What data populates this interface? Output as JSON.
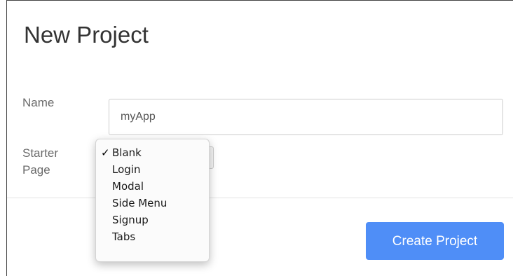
{
  "dialog": {
    "title": "New Project",
    "name_label": "Name",
    "name_value": "myApp",
    "starter_label": "Starter Page",
    "create_button_label": "Create Project"
  },
  "starter_dropdown": {
    "selected": "Blank",
    "check_glyph": "✓",
    "options": [
      "Blank",
      "Login",
      "Modal",
      "Side Menu",
      "Signup",
      "Tabs"
    ]
  },
  "colors": {
    "accent": "#4f8ef7",
    "title_text": "#333333",
    "label_text": "#6b6b6b"
  },
  "icons": {
    "selected_option": "checkmark-icon"
  }
}
